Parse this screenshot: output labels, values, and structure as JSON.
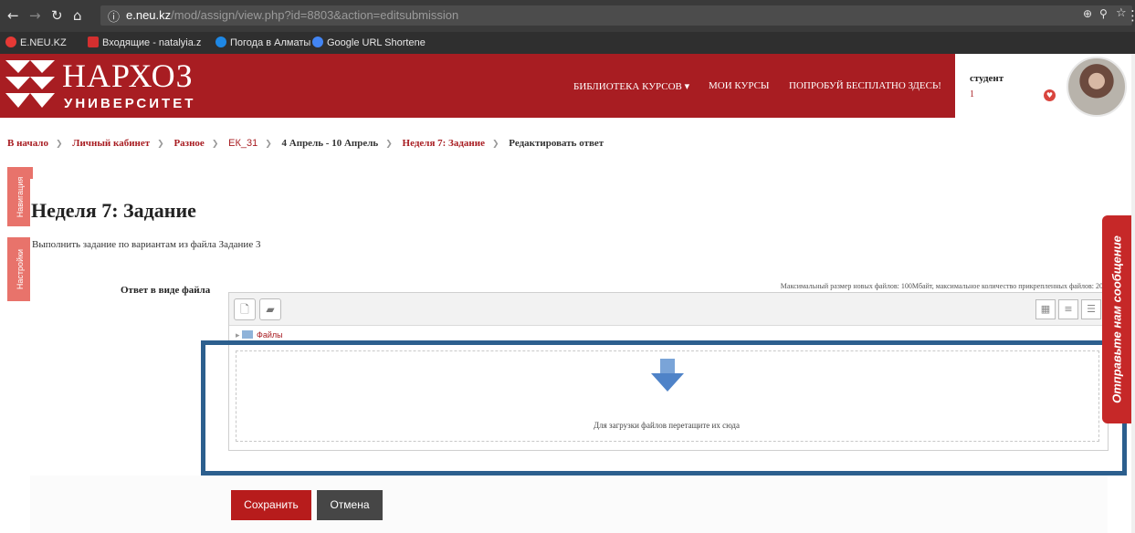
{
  "browser": {
    "url_domain": "e.neu.kz",
    "url_path": "/mod/assign/view.php?id=8803&action=editsubmission",
    "bookmarks": [
      {
        "label": "E.NEU.KZ",
        "color": "#e53935"
      },
      {
        "label": "Входящие - natalyia.z",
        "color": "#d32f2f"
      },
      {
        "label": "Погода в Алматы",
        "color": "#1e88e5"
      },
      {
        "label": "Google URL Shortene",
        "color": "#4285f4"
      }
    ]
  },
  "header": {
    "logo_title": "НАРХОЗ",
    "logo_subtitle": "УНИВЕРСИТЕТ",
    "nav": {
      "library": "БИБЛИОТЕКА КУРСОВ ▾",
      "my_courses": "МОИ КУРСЫ",
      "try_free": "ПОПРОБУЙ БЕСПЛАТНО ЗДЕСЬ!"
    },
    "user": {
      "role": "студент",
      "count": "1"
    }
  },
  "breadcrumb": {
    "home": "В начало",
    "cabinet": "Личный кабинет",
    "misc": "Разное",
    "course": "ЕК_31",
    "week_range": "4 Апрель - 10 Апрель",
    "assignment": "Неделя 7: Задание",
    "current": "Редактировать ответ"
  },
  "side_tabs": {
    "navigation": "Навигация",
    "settings": "Настройки"
  },
  "main": {
    "title": "Неделя 7: Задание",
    "description": "Выполнить задание по вариантам из файла Задание 3",
    "answer_label": "Ответ в виде файла",
    "limits": "Максимальный размер новых файлов: 100Мбайт, максимальное количество прикрепленных файлов: 20",
    "folder_label": "Файлы",
    "drop_hint": "Для загрузки файлов перетащите их сюда",
    "save_label": "Сохранить",
    "cancel_label": "Отмена"
  },
  "feedback": {
    "label": "Отправьте нам сообщение"
  },
  "colors": {
    "brand_red": "#a81d22",
    "highlight": "#2c5f8e"
  }
}
